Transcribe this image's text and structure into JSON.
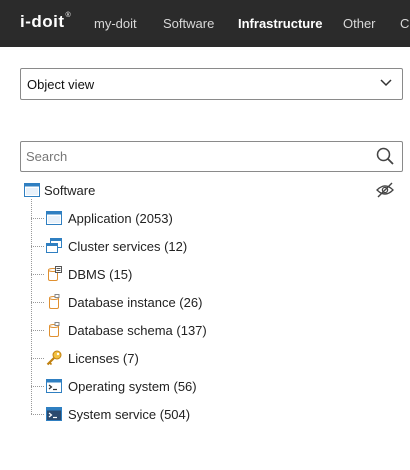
{
  "header": {
    "logo": "i-doit",
    "logo_mark": "®",
    "nav": [
      "my-doit",
      "Software",
      "Infrastructure",
      "Other",
      "C"
    ],
    "active": "Infrastructure"
  },
  "view_select": {
    "value": "Object view"
  },
  "search": {
    "placeholder": "Search"
  },
  "tree": {
    "root": {
      "label": "Software",
      "icon": "window-icon"
    },
    "items": [
      {
        "label": "Application (2053)",
        "icon": "application-window-icon"
      },
      {
        "label": "Cluster services (12)",
        "icon": "cluster-windows-icon"
      },
      {
        "label": "DBMS (15)",
        "icon": "dbms-icon"
      },
      {
        "label": "Database instance (26)",
        "icon": "database-instance-icon"
      },
      {
        "label": "Database schema (137)",
        "icon": "database-schema-icon"
      },
      {
        "label": "Licenses (7)",
        "icon": "key-icon"
      },
      {
        "label": "Operating system (56)",
        "icon": "terminal-icon"
      },
      {
        "label": "System service (504)",
        "icon": "system-service-icon"
      }
    ]
  },
  "colors": {
    "header_bg": "#2b2b2b",
    "window_blue": "#2f7fc1",
    "key_gold": "#e0a020"
  }
}
